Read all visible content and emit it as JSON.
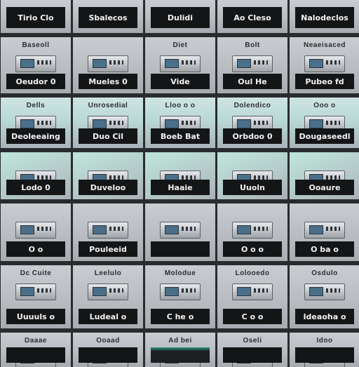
{
  "rows": [
    {
      "tiles": [
        {
          "top": "",
          "label": "Tirio Clo"
        },
        {
          "top": "",
          "label": "Sbalecos"
        },
        {
          "top": "",
          "label": "Dulidi"
        },
        {
          "top": "",
          "label": "Ao Cleso"
        },
        {
          "top": "",
          "label": "Nalodeclos"
        }
      ]
    },
    {
      "tiles": [
        {
          "top": "Baseoll",
          "label": "Oeudor 0"
        },
        {
          "top": "",
          "label": "Mueles 0"
        },
        {
          "top": "Diet",
          "label": "Vide"
        },
        {
          "top": "Bolt",
          "label": "Oul He"
        },
        {
          "top": "Neaeisaced",
          "label": "Pubeo fd"
        }
      ]
    },
    {
      "tiles": [
        {
          "top": "Dells",
          "label": "Deoleeaing"
        },
        {
          "top": "Unrosedial",
          "label": "Duo Cil"
        },
        {
          "top": "Lloo o o",
          "label": "Boeb Bat"
        },
        {
          "top": "Dolendico",
          "label": "Orbdoo 0"
        },
        {
          "top": "Ooo o",
          "label": "Dougaseedl"
        }
      ]
    },
    {
      "tiles": [
        {
          "top": "",
          "label": "Lodo 0"
        },
        {
          "top": "",
          "label": "Duveloo"
        },
        {
          "top": "",
          "label": "Haaie"
        },
        {
          "top": "",
          "label": "Uuoln"
        },
        {
          "top": "",
          "label": "Ooaure"
        }
      ]
    },
    {
      "tiles": [
        {
          "top": "",
          "label": "O o"
        },
        {
          "top": "",
          "label": "Pouleeid"
        },
        {
          "top": "",
          "label": ""
        },
        {
          "top": "",
          "label": "O o o"
        },
        {
          "top": "",
          "label": "O ba o"
        }
      ]
    },
    {
      "tiles": [
        {
          "top": "Dc Cuite",
          "label": "Uuuuls o"
        },
        {
          "top": "Leelulo",
          "label": "Ludeal o"
        },
        {
          "top": "Molodue",
          "label": "C he o"
        },
        {
          "top": "Lolooedo",
          "label": "C o o"
        },
        {
          "top": "Osdulo",
          "label": "Ideaoha o"
        }
      ]
    },
    {
      "tiles": [
        {
          "top": "Daaae",
          "label": ""
        },
        {
          "top": "Ooaad",
          "label": ""
        },
        {
          "top": "Ad bei",
          "label": ""
        },
        {
          "top": "Oseli",
          "label": ""
        },
        {
          "top": "Idoo",
          "label": ""
        }
      ]
    }
  ]
}
